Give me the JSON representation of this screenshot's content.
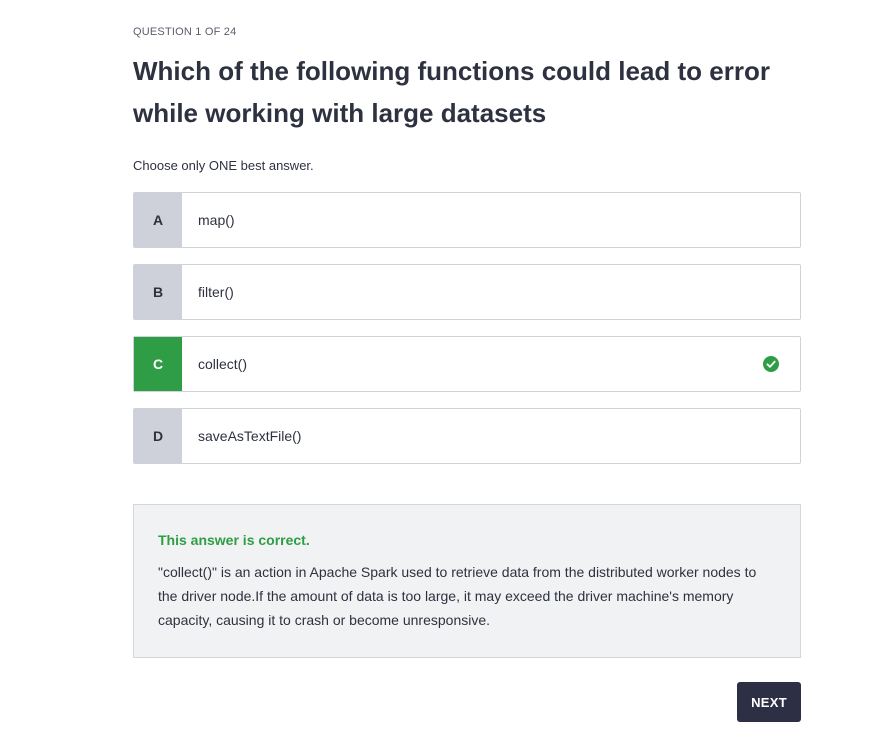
{
  "quiz": {
    "counter": "QUESTION 1 OF 24",
    "question": "Which of the following functions could lead to error while working with large datasets",
    "instruction": "Choose only ONE best answer.",
    "options": [
      {
        "letter": "A",
        "text": "map()",
        "correct": false
      },
      {
        "letter": "B",
        "text": "filter()",
        "correct": false
      },
      {
        "letter": "C",
        "text": "collect()",
        "correct": true
      },
      {
        "letter": "D",
        "text": "saveAsTextFile()",
        "correct": false
      }
    ],
    "feedback": {
      "verdict": "This answer is correct.",
      "explanation": "\"collect()\" is an action in Apache Spark used to retrieve data from the distributed worker nodes to the driver node.If the amount of data is too large, it may exceed the driver machine's memory capacity, causing it to crash or become unresponsive."
    },
    "next_label": "NEXT"
  },
  "colors": {
    "correct_green": "#2f9d46",
    "letter_gray": "#cfd1da",
    "button_dark": "#2d2f45",
    "feedback_bg": "#f1f2f3"
  },
  "icons": {
    "check": "check-circle-icon"
  }
}
